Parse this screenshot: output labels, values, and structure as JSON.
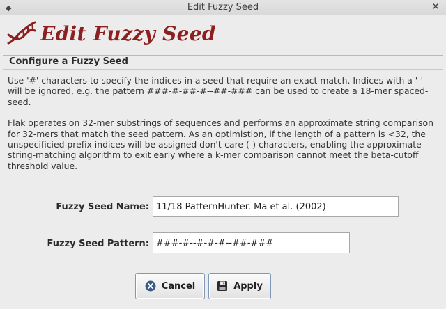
{
  "window": {
    "title": "Edit Fuzzy Seed",
    "menu_glyph": "◆",
    "close_glyph": "✕"
  },
  "header": {
    "title": "Edit Fuzzy Seed",
    "logo_icon": "dna-icon"
  },
  "panel": {
    "legend": "Configure a Fuzzy Seed",
    "paragraph1": "Use '#' characters to specify the indices in a seed that require an exact match. Indices with a '-' will be ignored, e.g. the pattern ###-#-##-#--##-### can be used to create a 18-mer spaced-seed.",
    "paragraph2": "Flak operates on 32-mer substrings of sequences and performs an approximate string comparison for 32-mers that match the seed pattern. As an optimistion, if the length of a pattern is <32, the unspecificied prefix indices will be assigned don't-care (-) characters, enabling the approximate string-matching algorithm to exit early where a k-mer comparison cannot meet the beta-cutoff threshold value."
  },
  "form": {
    "name_label": "Fuzzy Seed Name:",
    "name_value": "11/18 PatternHunter. Ma et al. (2002)",
    "pattern_label": "Fuzzy Seed Pattern:",
    "pattern_value": "###-#--#-#-#--##-###"
  },
  "buttons": {
    "cancel_label": "Cancel",
    "cancel_icon": "cancel-icon",
    "apply_label": "Apply",
    "apply_icon": "save-icon"
  },
  "colors": {
    "header_title": "#8c1f1f",
    "cancel_icon_bg": "#3b5b86"
  }
}
